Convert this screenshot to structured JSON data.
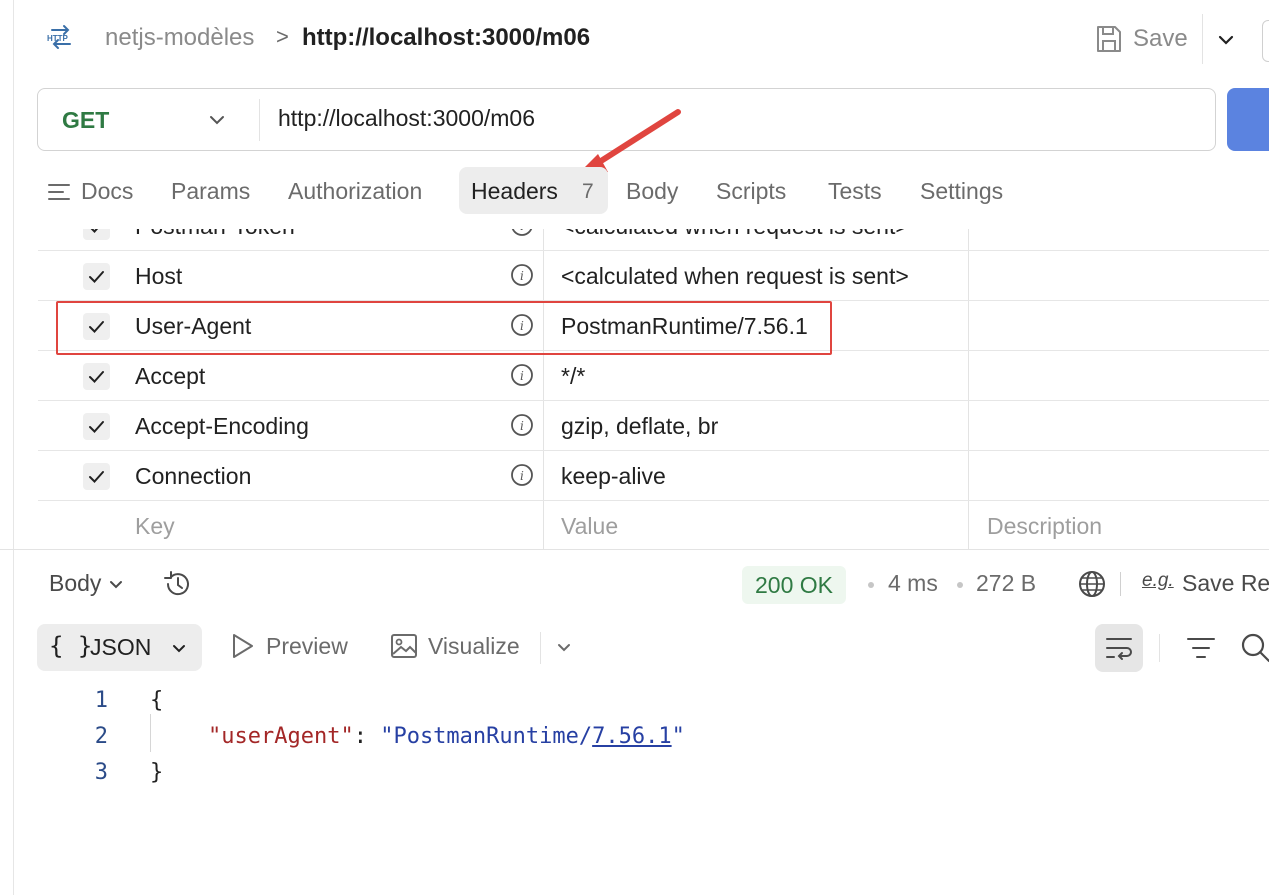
{
  "header": {
    "protocol_icon": "http-icon",
    "collection": "netjs-modèles",
    "separator": ">",
    "request_title": "http://localhost:3000/m06",
    "save_label": "Save"
  },
  "request": {
    "method": "GET",
    "url": "http://localhost:3000/m06"
  },
  "tabs": [
    {
      "label": "Docs"
    },
    {
      "label": "Params"
    },
    {
      "label": "Authorization"
    },
    {
      "label": "Headers",
      "count": "7",
      "active": true
    },
    {
      "label": "Body"
    },
    {
      "label": "Scripts"
    },
    {
      "label": "Tests"
    },
    {
      "label": "Settings"
    }
  ],
  "headers_table": {
    "rows": [
      {
        "key": "Postman-Token",
        "value": "<calculated when request is sent>",
        "checked": true
      },
      {
        "key": "Host",
        "value": "<calculated when request is sent>",
        "checked": true
      },
      {
        "key": "User-Agent",
        "value": "PostmanRuntime/7.56.1",
        "checked": true,
        "highlighted": true
      },
      {
        "key": "Accept",
        "value": "*/*",
        "checked": true
      },
      {
        "key": "Accept-Encoding",
        "value": "gzip, deflate, br",
        "checked": true
      },
      {
        "key": "Connection",
        "value": "keep-alive",
        "checked": true
      }
    ],
    "placeholder": {
      "key": "Key",
      "value": "Value",
      "description": "Description"
    }
  },
  "response": {
    "section_label": "Body",
    "status": "200 OK",
    "time": "4 ms",
    "size": "272 B",
    "eg_label": "e.g.",
    "save_label": "Save Re",
    "format": "JSON",
    "format_brace": "{ }",
    "preview_label": "Preview",
    "visualize_label": "Visualize",
    "code": {
      "line_numbers": [
        "1",
        "2",
        "3"
      ],
      "open": "{",
      "key": "\"userAgent\"",
      "colon": ": ",
      "value_prefix": "\"PostmanRuntime/",
      "value_link": "7.56.1",
      "value_suffix": "\"",
      "close": "}"
    }
  },
  "colors": {
    "method_get": "#2f7a43",
    "status_ok": "#2f7a43",
    "annotation_red": "#e0453f",
    "send_button": "#5b83e0"
  }
}
